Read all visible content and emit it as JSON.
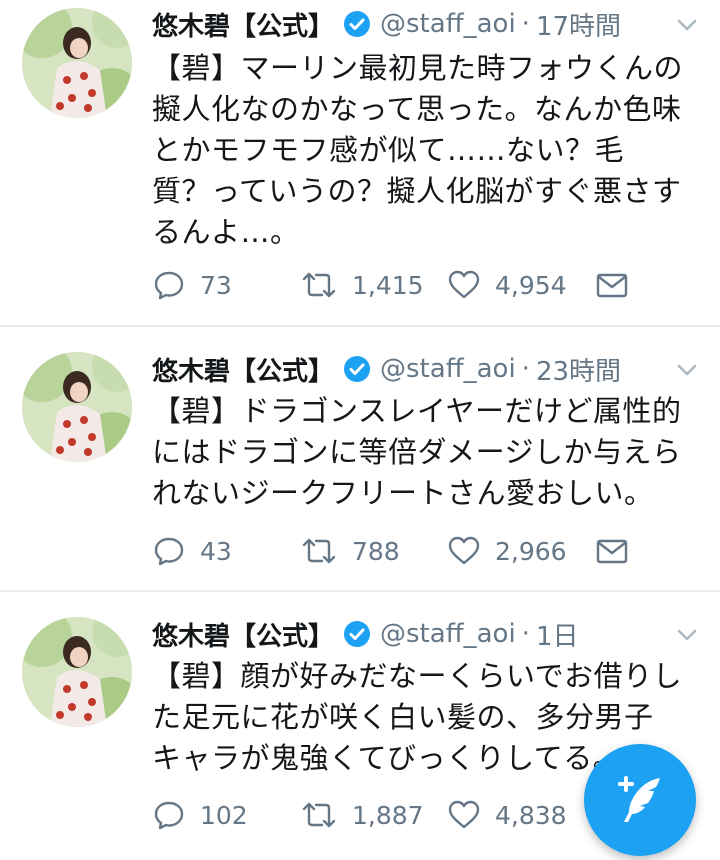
{
  "colors": {
    "accent": "#1da1f2",
    "muted": "#657786",
    "text": "#14171a",
    "divider": "#e6ecf0"
  },
  "tweets": [
    {
      "name": "悠木碧【公式】",
      "handle": "@staff_aoi",
      "separator": "·",
      "time": "17時間",
      "lines": [
        "【碧】マーリン最初見た時フォウくんの",
        "擬人化なのかなって思った。なんか色味",
        "とかモフモフ感が似て……ない？毛",
        "質？っていうの？擬人化脳がすぐ悪さす",
        "るんよ…。"
      ],
      "replies": "73",
      "retweets": "1,415",
      "likes": "4,954"
    },
    {
      "name": "悠木碧【公式】",
      "handle": "@staff_aoi",
      "separator": "·",
      "time": "23時間",
      "lines": [
        "【碧】ドラゴンスレイヤーだけど属性的",
        "にはドラゴンに等倍ダメージしか与えら",
        "れないジークフリートさん愛おしい。"
      ],
      "replies": "43",
      "retweets": "788",
      "likes": "2,966"
    },
    {
      "name": "悠木碧【公式】",
      "handle": "@staff_aoi",
      "separator": "·",
      "time": "1日",
      "lines": [
        "【碧】顔が好みだなーくらいでお借りし",
        "た足元に花が咲く白い髪の、多分男子",
        "キャラが鬼強くてびっくりしてる。"
      ],
      "replies": "102",
      "retweets": "1,887",
      "likes": "4,838"
    }
  ],
  "icons": {
    "verified": "verified-badge-icon",
    "caret": "chevron-down-icon",
    "reply": "reply-icon",
    "retweet": "retweet-icon",
    "like": "heart-icon",
    "dm": "envelope-icon",
    "compose": "compose-tweet-icon"
  }
}
